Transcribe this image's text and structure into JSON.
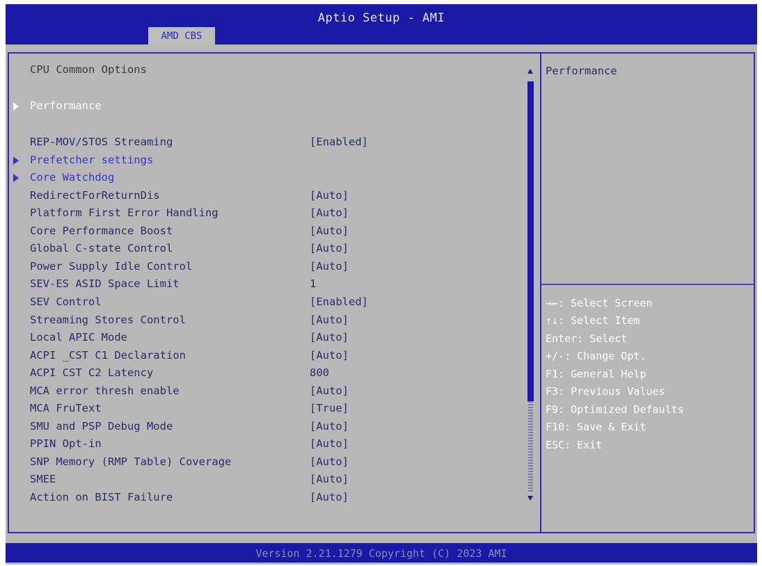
{
  "header": {
    "title": "Aptio Setup - AMI",
    "tab_label": "AMD CBS"
  },
  "main": {
    "section_title": "CPU Common Options",
    "items": [
      {
        "label": "Performance",
        "value": "",
        "type": "submenu",
        "selected": true
      },
      {
        "label": "REP-MOV/STOS Streaming",
        "value": "[Enabled]",
        "type": "option"
      },
      {
        "label": "Prefetcher settings",
        "value": "",
        "type": "submenu"
      },
      {
        "label": "Core Watchdog",
        "value": "",
        "type": "submenu"
      },
      {
        "label": "RedirectForReturnDis",
        "value": "[Auto]",
        "type": "option"
      },
      {
        "label": "Platform First Error Handling",
        "value": "[Auto]",
        "type": "option"
      },
      {
        "label": "Core Performance Boost",
        "value": "[Auto]",
        "type": "option"
      },
      {
        "label": "Global C-state Control",
        "value": "[Auto]",
        "type": "option"
      },
      {
        "label": "Power Supply Idle Control",
        "value": "[Auto]",
        "type": "option"
      },
      {
        "label": "SEV-ES ASID Space Limit",
        "value": "1",
        "type": "option"
      },
      {
        "label": "SEV Control",
        "value": "[Enabled]",
        "type": "option"
      },
      {
        "label": "Streaming Stores Control",
        "value": "[Auto]",
        "type": "option"
      },
      {
        "label": "Local APIC Mode",
        "value": "[Auto]",
        "type": "option"
      },
      {
        "label": "ACPI _CST C1 Declaration",
        "value": "[Auto]",
        "type": "option"
      },
      {
        "label": "ACPI CST C2 Latency",
        "value": "800",
        "type": "option"
      },
      {
        "label": "MCA error thresh enable",
        "value": "[Auto]",
        "type": "option"
      },
      {
        "label": "MCA FruText",
        "value": "[True]",
        "type": "option"
      },
      {
        "label": "SMU and PSP Debug Mode",
        "value": "[Auto]",
        "type": "option"
      },
      {
        "label": "PPIN Opt-in",
        "value": "[Auto]",
        "type": "option"
      },
      {
        "label": "SNP Memory (RMP Table) Coverage",
        "value": "[Auto]",
        "type": "option"
      },
      {
        "label": "SMEE",
        "value": "[Auto]",
        "type": "option"
      },
      {
        "label": "Action on BIST Failure",
        "value": "[Auto]",
        "type": "option"
      }
    ]
  },
  "help": {
    "title": "Performance",
    "keys": [
      "→←: Select Screen",
      "↑↓: Select Item",
      "Enter: Select",
      "+/-: Change Opt.",
      "F1: General Help",
      "F3: Previous Values",
      "F9: Optimized Defaults",
      "F10: Save & Exit",
      "ESC: Exit"
    ]
  },
  "footer": {
    "version": "Version 2.21.1279 Copyright (C) 2023 AMI"
  },
  "colors": {
    "bar_blue": "#1a1aa6",
    "panel_gray": "#b8b8b8",
    "text_dark": "#2b2b6a",
    "submenu_blue": "#3535c8",
    "highlight_white": "#ffffff"
  }
}
